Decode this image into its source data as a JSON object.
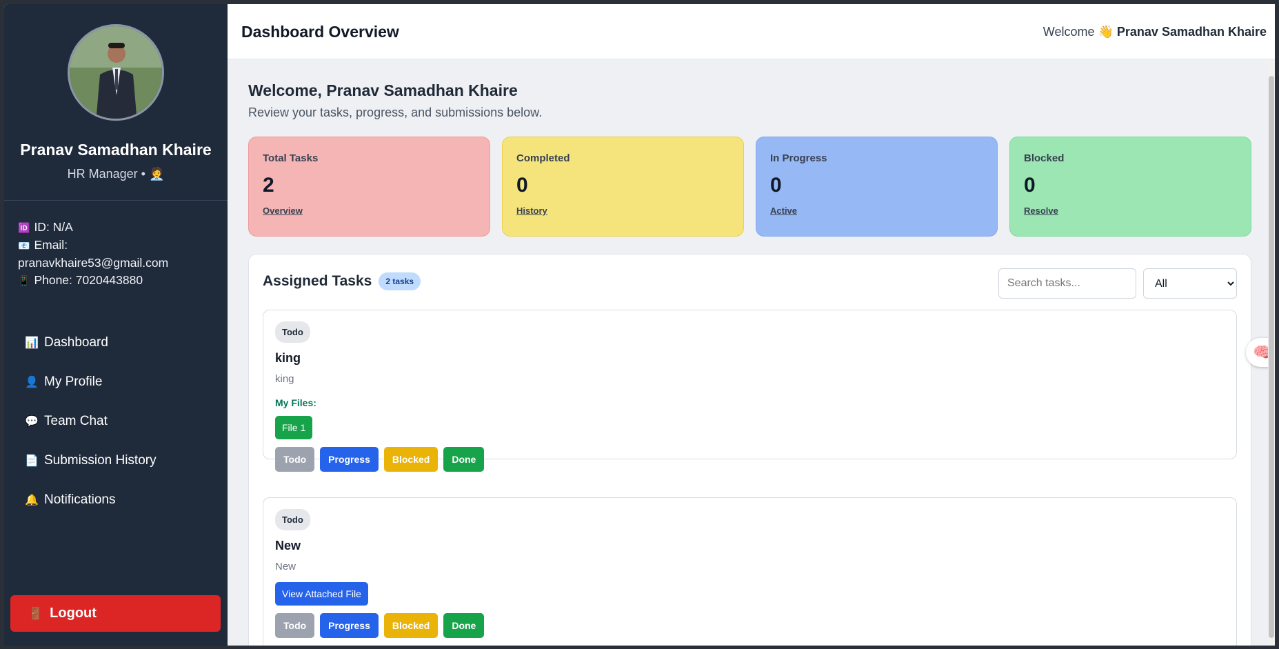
{
  "profile": {
    "name": "Pranav Samadhan Khaire",
    "role": "HR Manager • 🧑‍💼",
    "id_text": "ID: N/A",
    "email_label": "Email:",
    "email_value": "pranavkhaire53@gmail.com",
    "phone_text": "Phone: 7020443880"
  },
  "nav": [
    {
      "icon": "📊",
      "label": "Dashboard"
    },
    {
      "icon": "👤",
      "label": "My Profile"
    },
    {
      "icon": "💬",
      "label": "Team Chat"
    },
    {
      "icon": "📄",
      "label": "Submission History"
    },
    {
      "icon": "🔔",
      "label": "Notifications"
    }
  ],
  "logout_label": "Logout",
  "header": {
    "title": "Dashboard Overview",
    "welcome_prefix": "Welcome 👋",
    "welcome_name": "Pranav Samadhan Khaire"
  },
  "welcome": {
    "title": "Welcome, Pranav Samadhan Khaire",
    "subtitle": "Review your tasks, progress, and submissions below."
  },
  "stats": [
    {
      "label": "Total Tasks",
      "value": "2",
      "link": "Overview",
      "color": "#f5b5b5",
      "border": "#f09a9a"
    },
    {
      "label": "Completed",
      "value": "0",
      "link": "History",
      "color": "#f5e47c",
      "border": "#ecd14f"
    },
    {
      "label": "In Progress",
      "value": "0",
      "link": "Active",
      "color": "#96b8f5",
      "border": "#86a9ec"
    },
    {
      "label": "Blocked",
      "value": "0",
      "link": "Resolve",
      "color": "#9be6b3",
      "border": "#7edb9d"
    }
  ],
  "tasks_panel": {
    "title": "Assigned Tasks",
    "count_badge": "2 tasks",
    "search_placeholder": "Search tasks...",
    "filter_selected": "All"
  },
  "tasks": [
    {
      "status": "Todo",
      "title": "king",
      "desc": "king",
      "files_label": "My Files:",
      "file_button": "File 1"
    },
    {
      "status": "Todo",
      "title": "New",
      "desc": "New",
      "view_button": "View Attached File"
    }
  ],
  "actions": {
    "todo": "Todo",
    "progress": "Progress",
    "blocked": "Blocked",
    "done": "Done"
  }
}
